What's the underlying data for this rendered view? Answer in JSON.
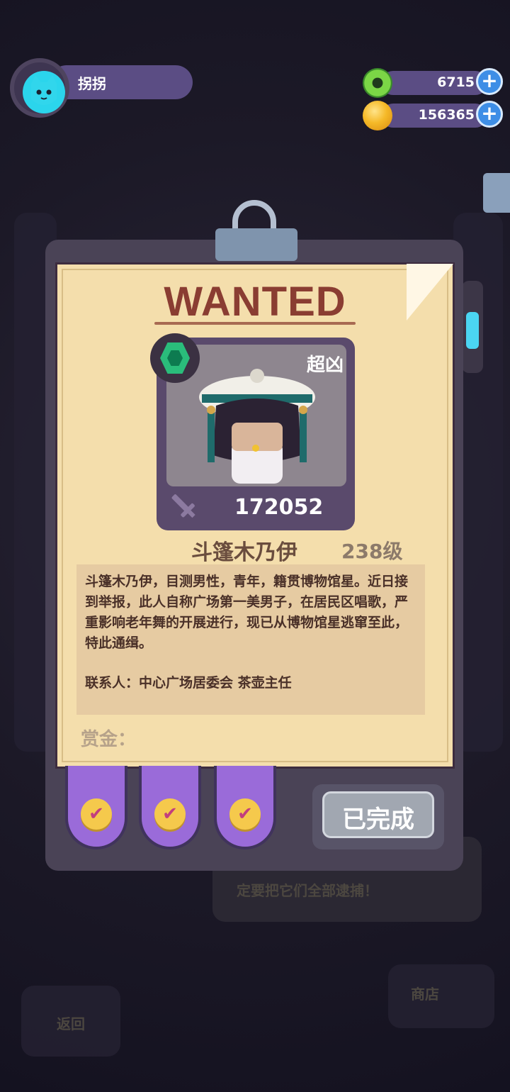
{
  "player": {
    "name": "拐拐"
  },
  "currencies": [
    {
      "icon": "green-donut-coin-icon",
      "value": "6715"
    },
    {
      "icon": "gold-planet-coin-icon",
      "value": "156365"
    }
  ],
  "wanted": {
    "title": "WANTED",
    "danger_tag": "超凶",
    "power": "172052",
    "name": "斗篷木乃伊",
    "level": "238级",
    "description": "斗篷木乃伊，目测男性，青年，籍贯博物馆星。近日接到举报，此人自称广场第一美男子，在居民区唱歌，严重影响老年舞的开展进行，现已从博物馆星逃窜至此，特此通缉。",
    "contact": "联系人：中心广场居委会 茶壶主任",
    "bounty_label": "赏金："
  },
  "tabs": [
    {
      "state": "checked",
      "mark": "✔"
    },
    {
      "state": "checked",
      "mark": "✔"
    },
    {
      "state": "checked",
      "mark": "✔"
    }
  ],
  "complete_button": "已完成",
  "background_text": {
    "hint": "定要把它们全部逮捕！",
    "back": "返回",
    "shop": "商店"
  }
}
